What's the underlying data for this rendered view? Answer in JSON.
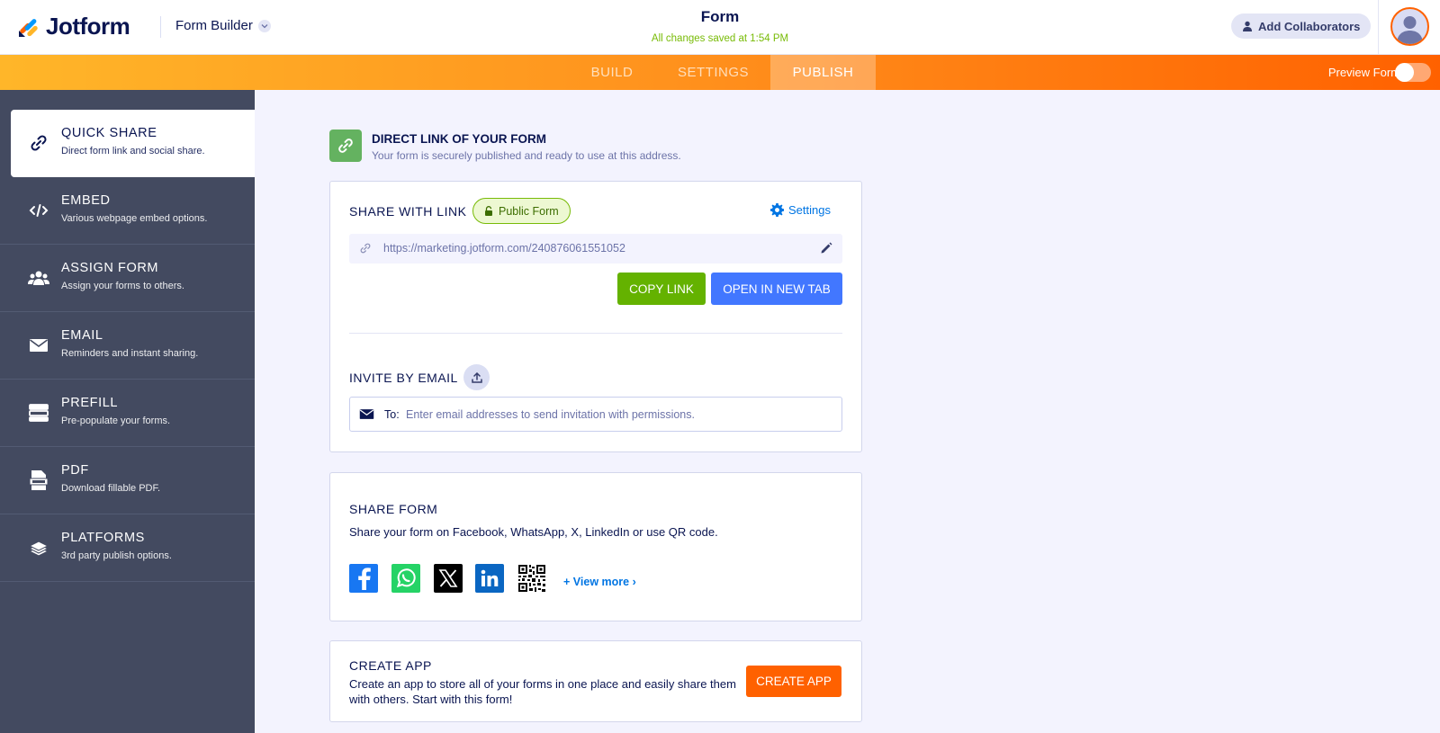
{
  "header": {
    "logo_text": "Jotform",
    "builder_label": "Form Builder",
    "form_title": "Form",
    "saved_status": "All changes saved at 1:54 PM",
    "collab_label": "Add Collaborators"
  },
  "nav": {
    "tabs": [
      {
        "label": "BUILD"
      },
      {
        "label": "SETTINGS"
      },
      {
        "label": "PUBLISH"
      }
    ],
    "active_tab": "PUBLISH",
    "preview_label": "Preview Form",
    "preview_enabled": false
  },
  "sidebar": {
    "items": [
      {
        "title": "QUICK SHARE",
        "desc": "Direct form link and social share.",
        "icon": "link-icon"
      },
      {
        "title": "EMBED",
        "desc": "Various webpage embed options.",
        "icon": "code-icon"
      },
      {
        "title": "ASSIGN FORM",
        "desc": "Assign your forms to others.",
        "icon": "users-icon"
      },
      {
        "title": "EMAIL",
        "desc": "Reminders and instant sharing.",
        "icon": "envelope-icon"
      },
      {
        "title": "PREFILL",
        "desc": "Pre-populate your forms.",
        "icon": "prefill-icon"
      },
      {
        "title": "PDF",
        "desc": "Download fillable PDF.",
        "icon": "pdf-icon"
      },
      {
        "title": "PLATFORMS",
        "desc": "3rd party publish options.",
        "icon": "layers-icon"
      }
    ]
  },
  "direct_link": {
    "title": "DIRECT LINK OF YOUR FORM",
    "subtitle": "Your form is securely published and ready to use at this address."
  },
  "share_link": {
    "title": "SHARE WITH LINK",
    "badge": "Public Form",
    "settings_label": "Settings",
    "url": "https://marketing.jotform.com/240876061551052",
    "copy_label": "COPY LINK",
    "open_label": "OPEN IN NEW TAB"
  },
  "invite": {
    "title": "INVITE BY EMAIL",
    "to_label": "To:",
    "placeholder": "Enter email addresses to send invitation with permissions."
  },
  "share_form": {
    "title": "SHARE FORM",
    "desc": "Share your form on Facebook, WhatsApp, X, LinkedIn or use QR code.",
    "networks": [
      "facebook-icon",
      "whatsapp-icon",
      "x-icon",
      "linkedin-icon",
      "qr-code-icon"
    ],
    "view_more": "View more"
  },
  "create_app": {
    "title": "CREATE APP",
    "desc": "Create an app to store all of your forms in one place and easily share them with others. Start with this form!",
    "button_label": "CREATE APP"
  },
  "colors": {
    "brand_orange": "#ff6100",
    "green": "#78bb07",
    "blue": "#4277ff",
    "navy": "#0a1551",
    "sidebar": "#434a60"
  }
}
